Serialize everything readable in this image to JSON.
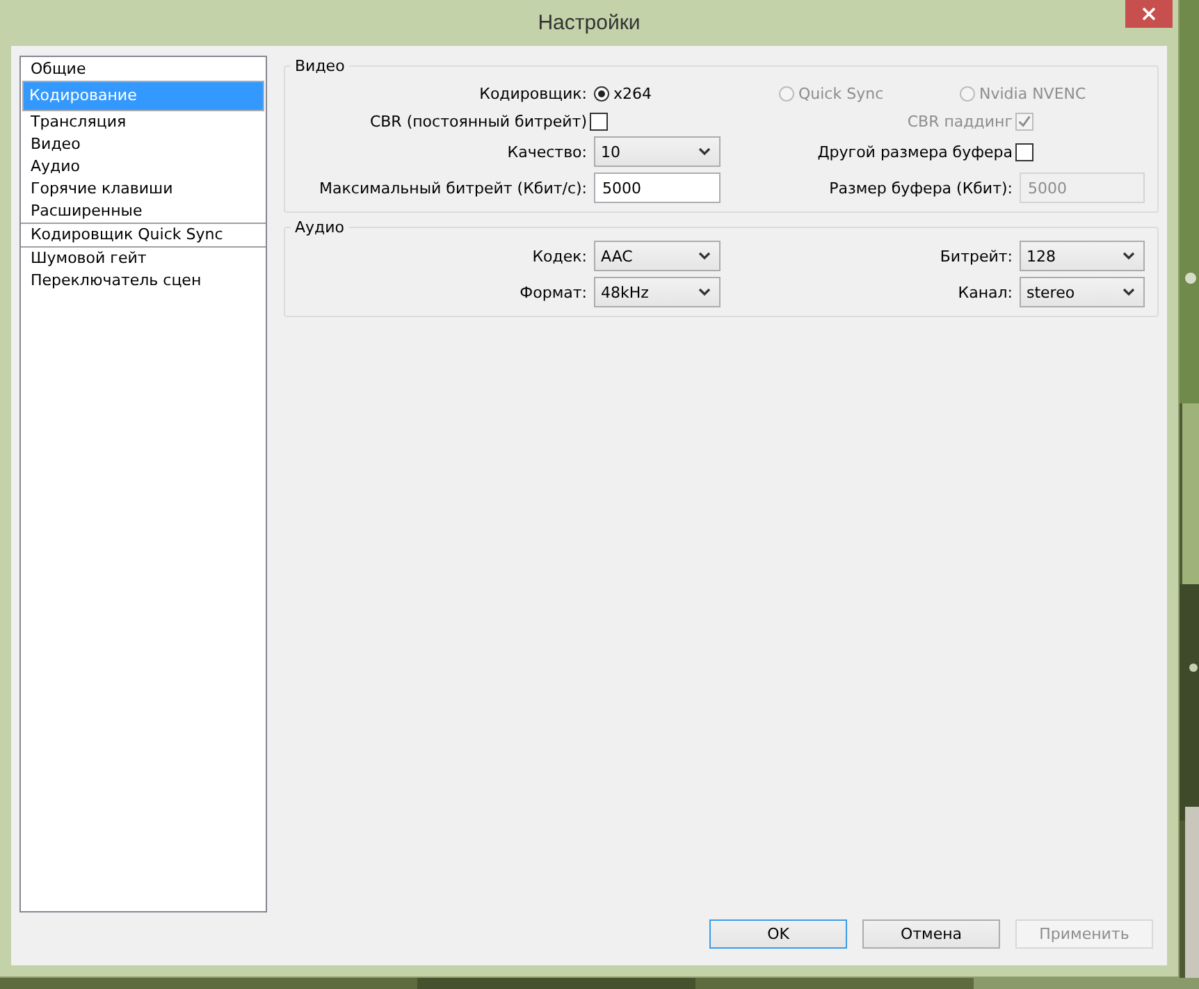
{
  "window": {
    "title": "Настройки"
  },
  "sidebar": {
    "groups": [
      [
        {
          "label": "Общие",
          "selected": false
        },
        {
          "label": "Кодирование",
          "selected": true
        },
        {
          "label": "Трансляция",
          "selected": false
        },
        {
          "label": "Видео",
          "selected": false
        },
        {
          "label": "Аудио",
          "selected": false
        },
        {
          "label": "Горячие клавиши",
          "selected": false
        },
        {
          "label": "Расширенные",
          "selected": false
        }
      ],
      [
        {
          "label": "Кодировщик Quick Sync",
          "selected": false
        }
      ],
      [
        {
          "label": "Шумовой гейт",
          "selected": false
        },
        {
          "label": "Переключатель сцен",
          "selected": false
        }
      ]
    ]
  },
  "video": {
    "title": "Видео",
    "encoder": {
      "label": "Кодировщик:",
      "options": [
        {
          "label": "x264",
          "selected": true,
          "disabled": false
        },
        {
          "label": "Quick Sync",
          "selected": false,
          "disabled": true
        },
        {
          "label": "Nvidia NVENC",
          "selected": false,
          "disabled": true
        }
      ]
    },
    "cbr": {
      "label": "CBR (постоянный битрейт)",
      "checked": false,
      "disabled": false
    },
    "cbr_padding": {
      "label": "CBR паддинг",
      "checked": true,
      "disabled": true
    },
    "quality": {
      "label": "Качество:",
      "value": "10"
    },
    "custom_buffer": {
      "label": "Другой размера буфера",
      "checked": false,
      "disabled": false
    },
    "max_bitrate": {
      "label": "Максимальный битрейт (Кбит/с):",
      "value": "5000",
      "disabled": false
    },
    "buffer_size": {
      "label": "Размер буфера (Кбит):",
      "value": "5000",
      "disabled": true
    }
  },
  "audio": {
    "title": "Аудио",
    "codec": {
      "label": "Кодек:",
      "value": "AAC"
    },
    "bitrate": {
      "label": "Битрейт:",
      "value": "128"
    },
    "format": {
      "label": "Формат:",
      "value": "48kHz"
    },
    "channel": {
      "label": "Канал:",
      "value": "stereo"
    }
  },
  "buttons": [
    {
      "label": "OK",
      "kind": "default",
      "disabled": false
    },
    {
      "label": "Отмена",
      "kind": "normal",
      "disabled": false
    },
    {
      "label": "Применить",
      "kind": "normal",
      "disabled": true
    }
  ]
}
